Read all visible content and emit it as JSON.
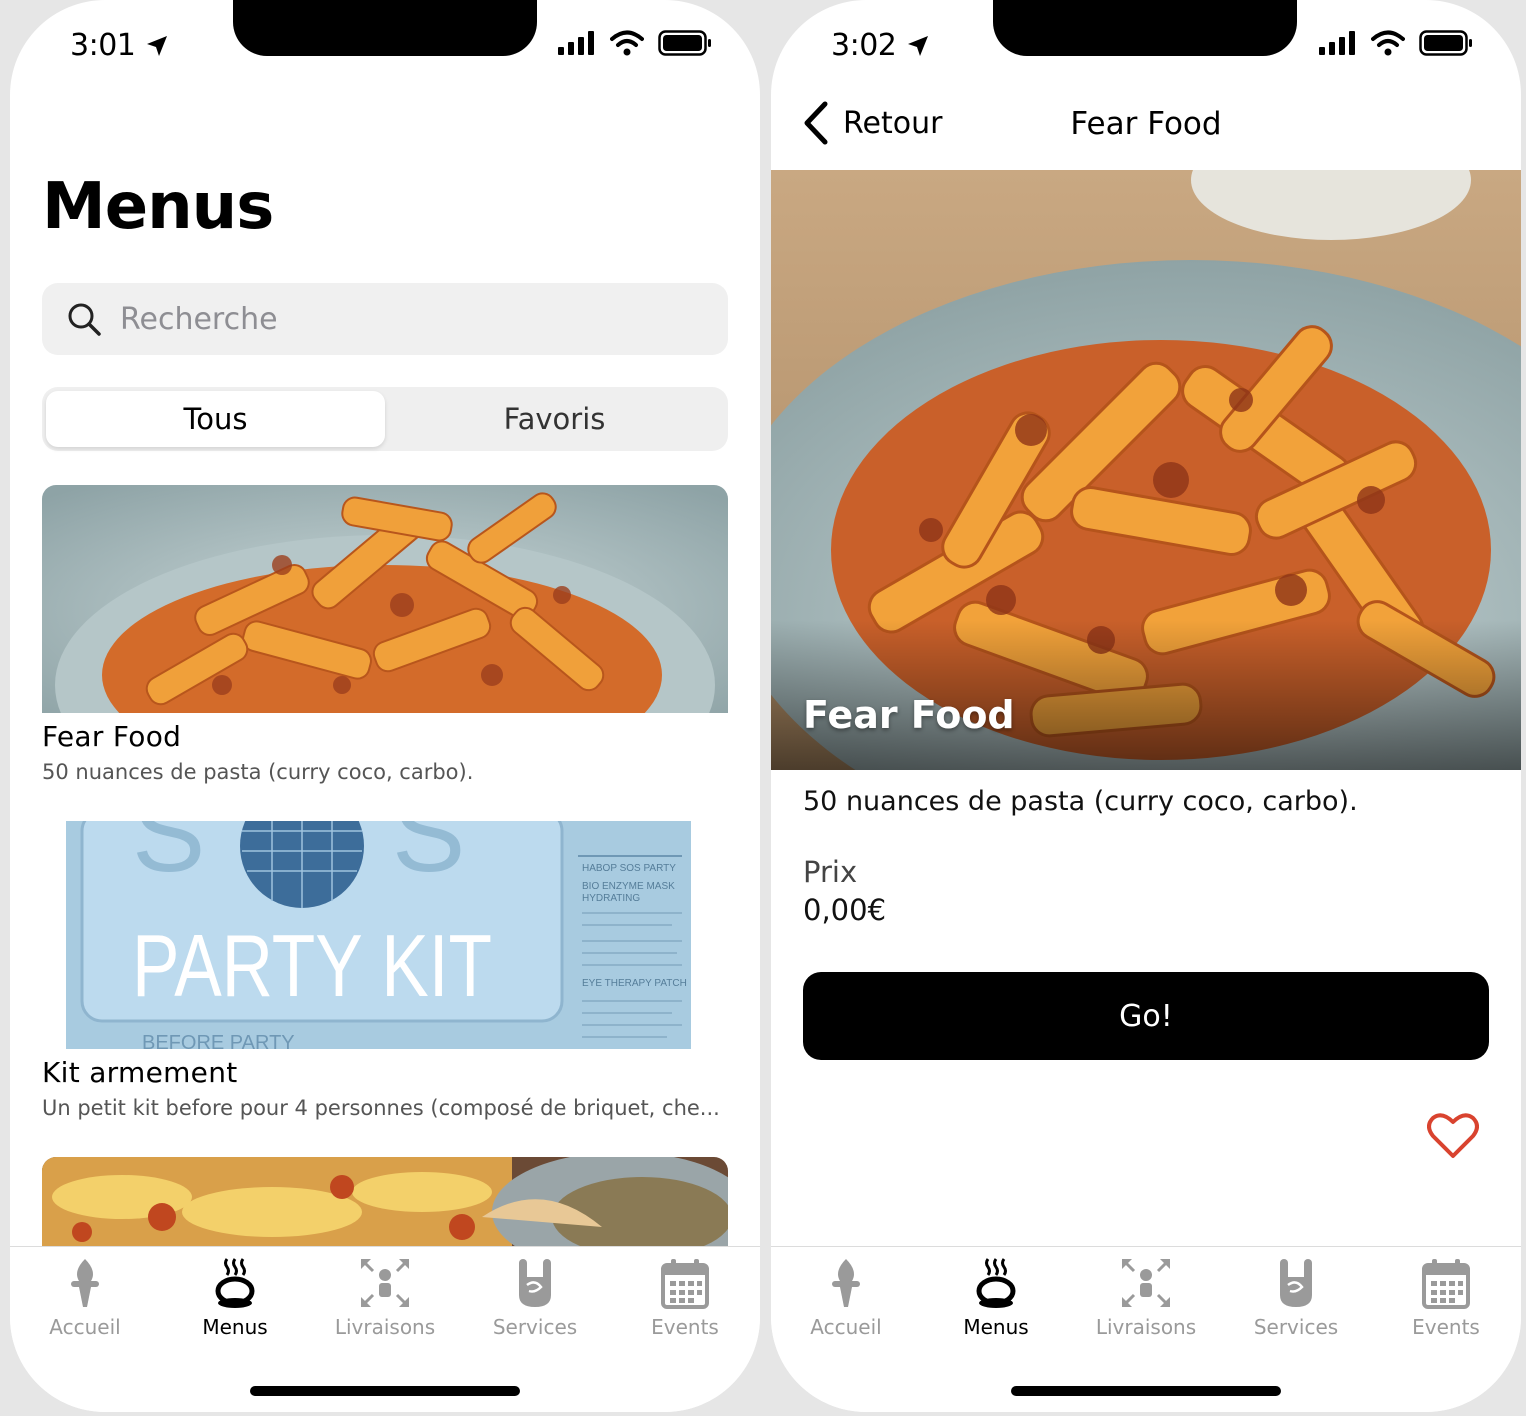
{
  "left_screen": {
    "status": {
      "time": "3:01"
    },
    "title": "Menus",
    "search": {
      "placeholder": "Recherche"
    },
    "segments": {
      "all": "Tous",
      "favorites": "Favoris"
    },
    "items": [
      {
        "title": "Fear Food",
        "description": "50 nuances de pasta (curry coco, carbo)."
      },
      {
        "title": "Kit armement",
        "description": "Un petit kit before pour 4 personnes (composé de briquet, che..."
      },
      {
        "title": "",
        "description": ""
      }
    ],
    "party_kit_image": {
      "main": "PARTY KIT",
      "before": "BEFORE PARTY",
      "side_lines": [
        "HABOP SOS PARTY",
        "BIO ENZYME MASK",
        "HYDRATING",
        "EYE THERAPY PATCH"
      ]
    }
  },
  "right_screen": {
    "status": {
      "time": "3:02"
    },
    "back_label": "Retour",
    "nav_title": "Fear Food",
    "hero_title": "Fear Food",
    "description": "50 nuances de pasta (curry coco, carbo).",
    "price_label": "Prix",
    "price_value": "0,00€",
    "cta_label": "Go!"
  },
  "tabbar": {
    "tabs": [
      {
        "label": "Accueil",
        "icon": "torch-icon",
        "active": false
      },
      {
        "label": "Menus",
        "icon": "hot-pot-icon",
        "active": true
      },
      {
        "label": "Livraisons",
        "icon": "people-arrows-icon",
        "active": false
      },
      {
        "label": "Services",
        "icon": "rock-hand-icon",
        "active": false
      },
      {
        "label": "Events",
        "icon": "calendar-icon",
        "active": false
      }
    ]
  },
  "colors": {
    "accent": "#000000",
    "inactive_tab": "#9a9a9a",
    "heart": "#d9432f",
    "search_bg": "#f0f0f0"
  }
}
